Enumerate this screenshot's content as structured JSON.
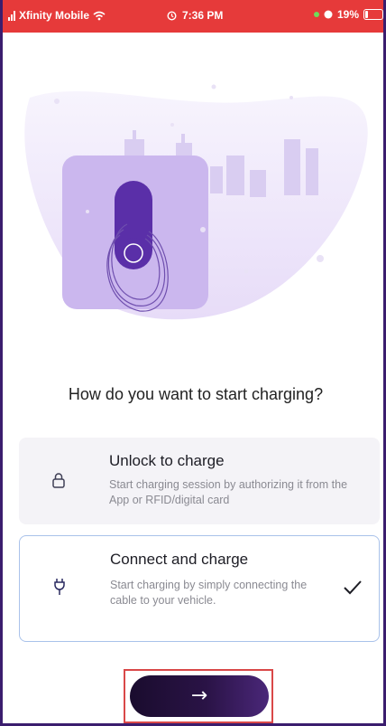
{
  "status_bar": {
    "carrier": "Xfinity Mobile",
    "time": "7:36 PM",
    "battery": "19%",
    "battery_level": 0.19
  },
  "question": "How do you want to start charging?",
  "options": [
    {
      "title": "Unlock to charge",
      "description": "Start charging session by authorizing it from the App or RFID/digital card",
      "icon": "lock-icon",
      "selected": false
    },
    {
      "title": "Connect and charge",
      "description": "Start charging by simply connecting the cable to your vehicle.",
      "icon": "plug-icon",
      "selected": true
    }
  ],
  "next_button": {
    "icon": "arrow-right-icon",
    "label": "→"
  },
  "colors": {
    "status_bar": "#e63a3a",
    "brand": "#5a2fa8",
    "selected_border": "#a9c2ea",
    "button": "#1a0c2e"
  }
}
